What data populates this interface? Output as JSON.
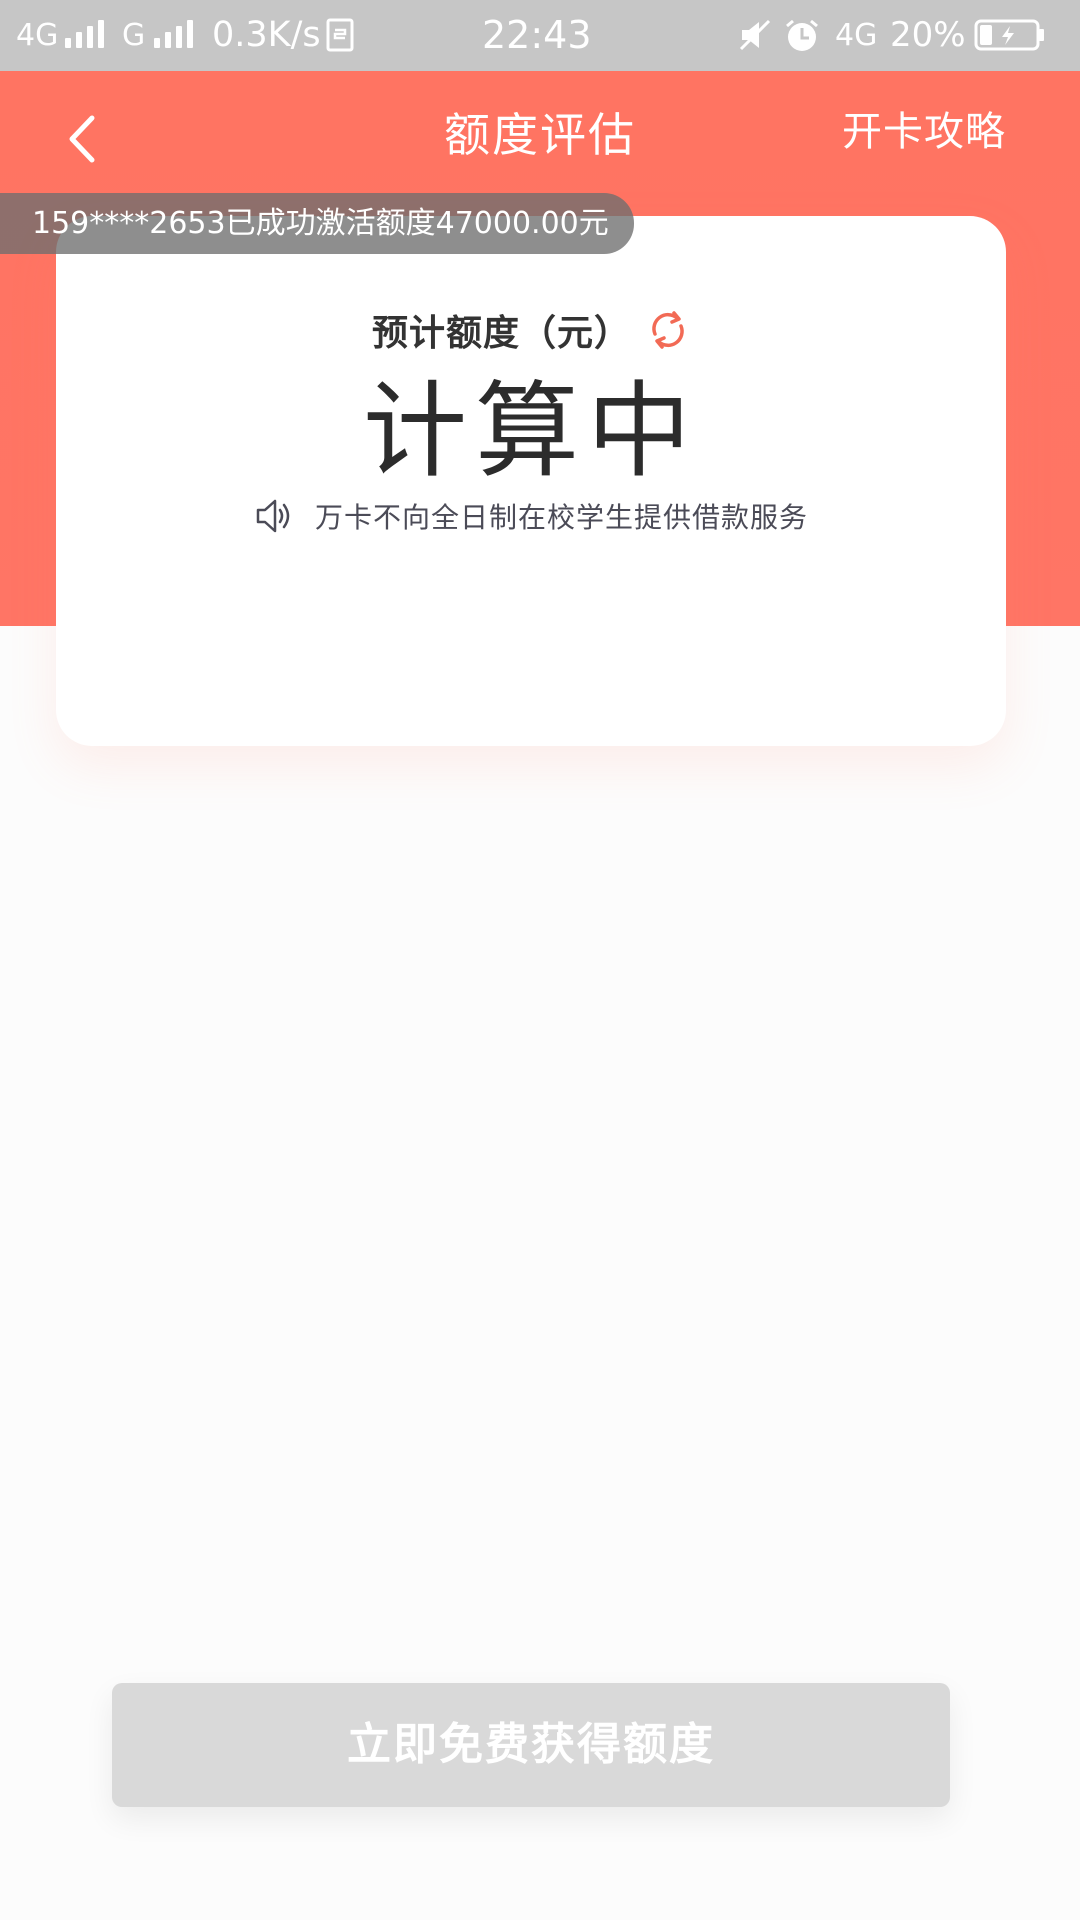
{
  "status_bar": {
    "network1": "4G",
    "network2": "G",
    "speed": "0.3K/s",
    "time": "22:43",
    "network3": "4G",
    "battery": "20%"
  },
  "header": {
    "title": "额度评估",
    "guide_link": "开卡攻略"
  },
  "toast": {
    "text": "159****2653已成功激活额度47000.00元"
  },
  "card": {
    "label": "预计额度（元）",
    "amount": "计算中",
    "notice": "万卡不向全日制在校学生提供借款服务"
  },
  "cta": {
    "label": "立即免费获得额度"
  },
  "colors": {
    "header_bg": "#ff7462",
    "accent": "#f26a55",
    "status_bar_bg": "#c6c6c6",
    "button_disabled": "#d9d9d9"
  },
  "icons": {
    "back": "chevron-left-icon",
    "refresh": "refresh-icon",
    "speaker": "speaker-icon",
    "sim": "sim-card-icon",
    "mute": "mute-icon",
    "alarm": "alarm-icon",
    "battery": "battery-charging-icon"
  }
}
